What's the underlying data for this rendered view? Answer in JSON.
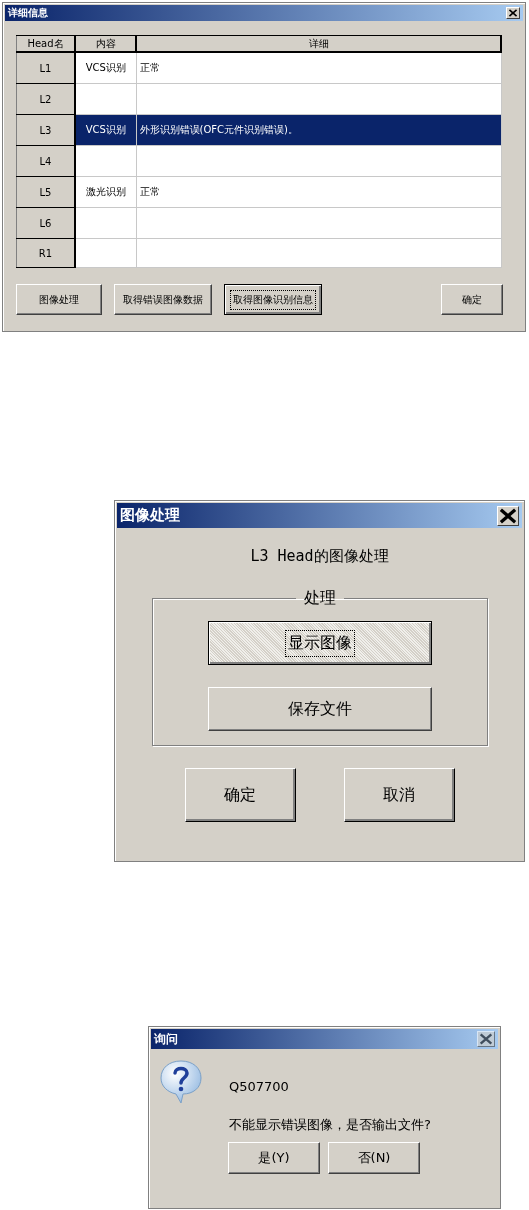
{
  "details_dialog": {
    "title": "详细信息",
    "columns": [
      "Head名",
      "内容",
      "详细"
    ],
    "rows": [
      {
        "head": "L1",
        "content": "VCS识别",
        "detail": "正常",
        "selected": false
      },
      {
        "head": "L2",
        "selected": false
      },
      {
        "head": "L3",
        "content": "VCS识别",
        "detail": "外形识别错误(OFC元件识别错误)。",
        "selected": true
      },
      {
        "head": "L4",
        "selected": false
      },
      {
        "head": "L5",
        "content": "激光识别",
        "detail": "正常",
        "selected": false
      },
      {
        "head": "L6",
        "selected": false
      },
      {
        "head": "R1",
        "selected": false
      }
    ],
    "buttons": [
      {
        "label": "图像处理",
        "focused": false
      },
      {
        "label": "取得错误图像数据",
        "focused": false
      },
      {
        "label": "取得图像识别信息",
        "focused": true
      },
      {
        "label": "确定",
        "focused": false
      }
    ]
  },
  "image_dialog": {
    "title": "图像处理",
    "heading": "L3 Head的图像处理",
    "group": {
      "legend": "处理",
      "buttons": [
        {
          "label": "显示图像",
          "focused": true
        },
        {
          "label": "保存文件",
          "focused": false
        }
      ]
    },
    "buttons": [
      {
        "label": "确定",
        "focused": false
      },
      {
        "label": "取消",
        "focused": false
      }
    ]
  },
  "confirm_dialog": {
    "title": "询问",
    "code": "Q507700",
    "message": "不能显示错误图像，是否输出文件?",
    "buttons": [
      {
        "label": "是(Y)",
        "focused": false
      },
      {
        "label": "否(N)",
        "focused": false
      }
    ]
  }
}
